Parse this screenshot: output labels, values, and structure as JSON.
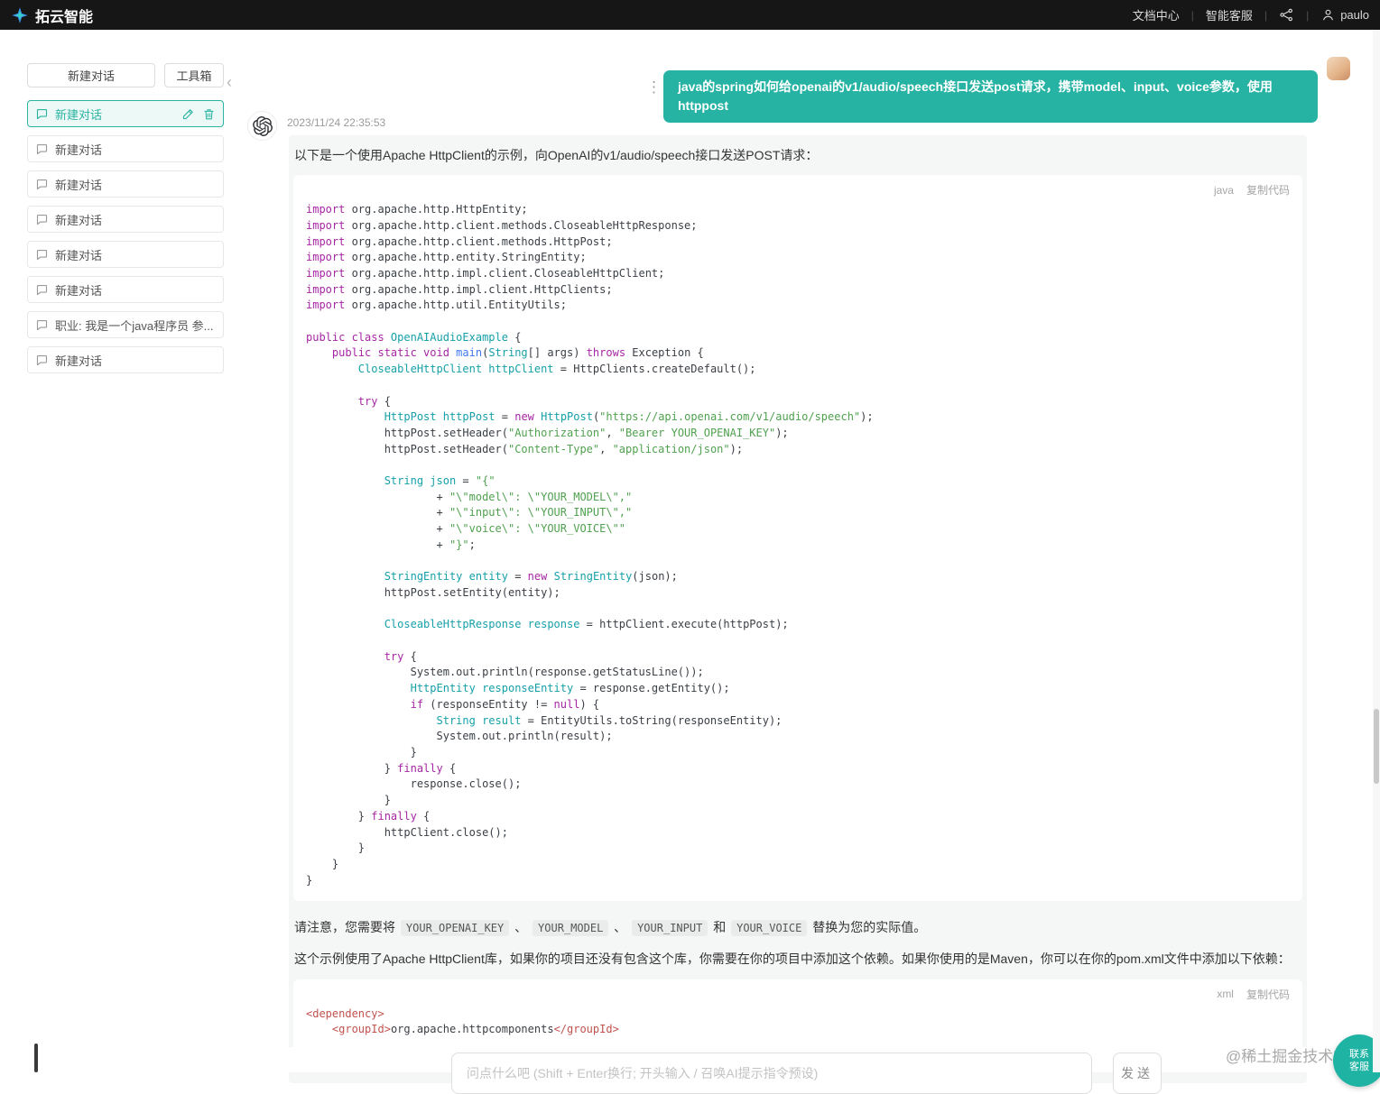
{
  "topbar": {
    "brand": "拓云智能",
    "links": [
      "文档中心",
      "智能客服"
    ],
    "username": "paulo"
  },
  "sidebar": {
    "new_chat_label": "新建对话",
    "toolbox_label": "工具箱",
    "conversations": [
      {
        "label": "新建对话",
        "active": true
      },
      {
        "label": "新建对话"
      },
      {
        "label": "新建对话"
      },
      {
        "label": "新建对话"
      },
      {
        "label": "新建对话"
      },
      {
        "label": "新建对话"
      },
      {
        "label": "职业: 我是一个java程序员 参..."
      },
      {
        "label": "新建对话"
      }
    ]
  },
  "chat": {
    "user_message": "java的spring如何给openai的v1/audio/speech接口发送post请求，携带model、input、voice参数，使用httppost",
    "timestamp": "2023/11/24 22:35:53",
    "intro": "以下是一个使用Apache HttpClient的示例，向OpenAI的v1/audio/speech接口发送POST请求：",
    "paragraph": "这个示例使用了Apache HttpClient库，如果你的项目还没有包含这个库，你需要在你的项目中添加这个依赖。如果你使用的是Maven，你可以在你的pom.xml文件中添加以下依赖：",
    "note_parts": [
      {
        "code": false,
        "text": "请注意，您需要将 "
      },
      {
        "code": true,
        "text": "YOUR_OPENAI_KEY"
      },
      {
        "code": false,
        "text": " 、 "
      },
      {
        "code": true,
        "text": "YOUR_MODEL"
      },
      {
        "code": false,
        "text": " 、 "
      },
      {
        "code": true,
        "text": "YOUR_INPUT"
      },
      {
        "code": false,
        "text": " 和 "
      },
      {
        "code": true,
        "text": "YOUR_VOICE"
      },
      {
        "code": false,
        "text": " 替换为您的实际值。"
      }
    ],
    "code_blocks": [
      {
        "lang": "java",
        "copy_label": "复制代码",
        "lines": [
          [
            [
              "k",
              "import"
            ],
            [
              "p",
              " org.apache.http.HttpEntity;"
            ]
          ],
          [
            [
              "k",
              "import"
            ],
            [
              "p",
              " org.apache.http.client.methods.CloseableHttpResponse;"
            ]
          ],
          [
            [
              "k",
              "import"
            ],
            [
              "p",
              " org.apache.http.client.methods.HttpPost;"
            ]
          ],
          [
            [
              "k",
              "import"
            ],
            [
              "p",
              " org.apache.http.entity.StringEntity;"
            ]
          ],
          [
            [
              "k",
              "import"
            ],
            [
              "p",
              " org.apache.http.impl.client.CloseableHttpClient;"
            ]
          ],
          [
            [
              "k",
              "import"
            ],
            [
              "p",
              " org.apache.http.impl.client.HttpClients;"
            ]
          ],
          [
            [
              "k",
              "import"
            ],
            [
              "p",
              " org.apache.http.util.EntityUtils;"
            ]
          ],
          [],
          [
            [
              "k",
              "public class"
            ],
            [
              "t",
              " OpenAIAudioExample"
            ],
            [
              "p",
              " {"
            ]
          ],
          [
            [
              "p",
              "    "
            ],
            [
              "k",
              "public static void"
            ],
            [
              "f",
              " main"
            ],
            [
              "p",
              "("
            ],
            [
              "t",
              "String"
            ],
            [
              "p",
              "[] args) "
            ],
            [
              "k",
              "throws"
            ],
            [
              "p",
              " Exception {"
            ]
          ],
          [
            [
              "p",
              "        "
            ],
            [
              "t",
              "CloseableHttpClient httpClient"
            ],
            [
              "p",
              " = HttpClients.createDefault();"
            ]
          ],
          [],
          [
            [
              "p",
              "        "
            ],
            [
              "k",
              "try"
            ],
            [
              "p",
              " {"
            ]
          ],
          [
            [
              "p",
              "            "
            ],
            [
              "t",
              "HttpPost httpPost"
            ],
            [
              "p",
              " = "
            ],
            [
              "k",
              "new"
            ],
            [
              "p",
              " "
            ],
            [
              "t",
              "HttpPost"
            ],
            [
              "p",
              "("
            ],
            [
              "s",
              "\"https://api.openai.com/v1/audio/speech\""
            ],
            [
              "p",
              ");"
            ]
          ],
          [
            [
              "p",
              "            httpPost.setHeader("
            ],
            [
              "s",
              "\"Authorization\""
            ],
            [
              "p",
              ", "
            ],
            [
              "s",
              "\"Bearer YOUR_OPENAI_KEY\""
            ],
            [
              "p",
              ");"
            ]
          ],
          [
            [
              "p",
              "            httpPost.setHeader("
            ],
            [
              "s",
              "\"Content-Type\""
            ],
            [
              "p",
              ", "
            ],
            [
              "s",
              "\"application/json\""
            ],
            [
              "p",
              ");"
            ]
          ],
          [],
          [
            [
              "p",
              "            "
            ],
            [
              "t",
              "String json"
            ],
            [
              "p",
              " = "
            ],
            [
              "s",
              "\"{\""
            ]
          ],
          [
            [
              "p",
              "                    + "
            ],
            [
              "s",
              "\"\\\"model\\\": \\\"YOUR_MODEL\\\",\""
            ]
          ],
          [
            [
              "p",
              "                    + "
            ],
            [
              "s",
              "\"\\\"input\\\": \\\"YOUR_INPUT\\\",\""
            ]
          ],
          [
            [
              "p",
              "                    + "
            ],
            [
              "s",
              "\"\\\"voice\\\": \\\"YOUR_VOICE\\\"\""
            ]
          ],
          [
            [
              "p",
              "                    + "
            ],
            [
              "s",
              "\"}\""
            ],
            [
              "p",
              ";"
            ]
          ],
          [],
          [
            [
              "p",
              "            "
            ],
            [
              "t",
              "StringEntity entity"
            ],
            [
              "p",
              " = "
            ],
            [
              "k",
              "new"
            ],
            [
              "p",
              " "
            ],
            [
              "t",
              "StringEntity"
            ],
            [
              "p",
              "(json);"
            ]
          ],
          [
            [
              "p",
              "            httpPost.setEntity(entity);"
            ]
          ],
          [],
          [
            [
              "p",
              "            "
            ],
            [
              "t",
              "CloseableHttpResponse response"
            ],
            [
              "p",
              " = httpClient.execute(httpPost);"
            ]
          ],
          [],
          [
            [
              "p",
              "            "
            ],
            [
              "k",
              "try"
            ],
            [
              "p",
              " {"
            ]
          ],
          [
            [
              "p",
              "                System.out.println(response.getStatusLine());"
            ]
          ],
          [
            [
              "p",
              "                "
            ],
            [
              "t",
              "HttpEntity responseEntity"
            ],
            [
              "p",
              " = response.getEntity();"
            ]
          ],
          [
            [
              "p",
              "                "
            ],
            [
              "k",
              "if"
            ],
            [
              "p",
              " (responseEntity != "
            ],
            [
              "k",
              "null"
            ],
            [
              "p",
              ") {"
            ]
          ],
          [
            [
              "p",
              "                    "
            ],
            [
              "t",
              "String result"
            ],
            [
              "p",
              " = EntityUtils.toString(responseEntity);"
            ]
          ],
          [
            [
              "p",
              "                    System.out.println(result);"
            ]
          ],
          [
            [
              "p",
              "                }"
            ]
          ],
          [
            [
              "p",
              "            } "
            ],
            [
              "k",
              "finally"
            ],
            [
              "p",
              " {"
            ]
          ],
          [
            [
              "p",
              "                response.close();"
            ]
          ],
          [
            [
              "p",
              "            }"
            ]
          ],
          [
            [
              "p",
              "        } "
            ],
            [
              "k",
              "finally"
            ],
            [
              "p",
              " {"
            ]
          ],
          [
            [
              "p",
              "            httpClient.close();"
            ]
          ],
          [
            [
              "p",
              "        }"
            ]
          ],
          [
            [
              "p",
              "    }"
            ]
          ],
          [
            [
              "p",
              "}"
            ]
          ]
        ]
      },
      {
        "lang": "xml",
        "copy_label": "复制代码",
        "lines": [
          [
            [
              "g",
              "<dependency>"
            ]
          ],
          [
            [
              "p",
              "    "
            ],
            [
              "g",
              "<groupId>"
            ],
            [
              "p",
              "org.apache.httpcomponents"
            ],
            [
              "g",
              "</groupId>"
            ]
          ]
        ]
      }
    ]
  },
  "composer": {
    "placeholder": "问点什么吧 (Shift + Enter换行; 开头输入 / 召唤AI提示指令预设)",
    "send_label": "发送"
  },
  "floating": {
    "watermark": "@稀土掘金技术社区",
    "contact_line1": "联系",
    "contact_line2": "客服"
  },
  "colors": {
    "accent": "#26b3a4",
    "topbar_bg": "#161616",
    "ai_message_bg": "#f5f7f6",
    "code_keyword": "#a626a4",
    "code_type": "#16a0a8",
    "code_string": "#50a14f",
    "code_function": "#4078f2",
    "code_tag": "#c0524e"
  }
}
